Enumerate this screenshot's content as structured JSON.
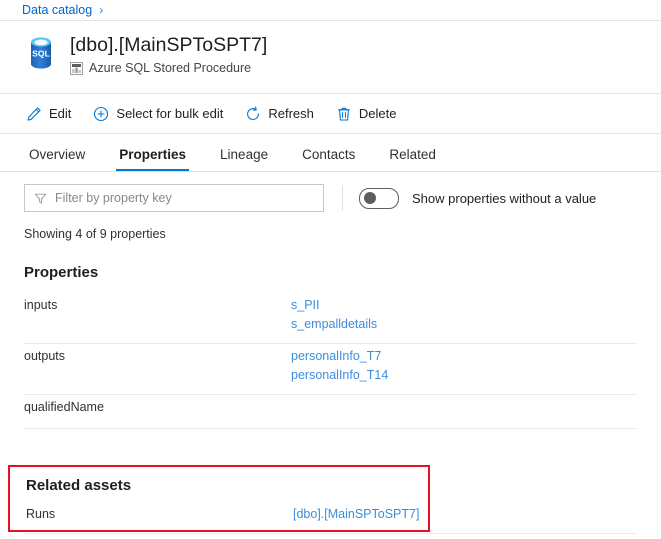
{
  "breadcrumb": {
    "items": [
      {
        "label": "Data catalog",
        "separator": "›"
      }
    ]
  },
  "asset": {
    "title": "[dbo].[MainSPToSPT7]",
    "subtitle": "Azure SQL Stored Procedure",
    "icon": "azure-sql-database-icon",
    "subtype_icon": "asset-type-icon"
  },
  "command_bar": {
    "items": [
      {
        "label": "Edit",
        "icon": "pencil-icon"
      },
      {
        "label": "Select for bulk edit",
        "icon": "plus-circle-icon"
      },
      {
        "label": "Refresh",
        "icon": "refresh-icon"
      },
      {
        "label": "Delete",
        "icon": "trash-icon"
      }
    ]
  },
  "tabs": [
    {
      "label": "Overview",
      "active": false
    },
    {
      "label": "Properties",
      "active": true
    },
    {
      "label": "Lineage",
      "active": false
    },
    {
      "label": "Contacts",
      "active": false
    },
    {
      "label": "Related",
      "active": false
    }
  ],
  "filter": {
    "placeholder": "Filter by property key",
    "value": "",
    "icon": "funnel-icon"
  },
  "toggle": {
    "label": "Show properties without a value",
    "state": "off"
  },
  "showing_text": "Showing 4 of 9 properties",
  "properties_section": {
    "heading": "Properties",
    "rows": [
      {
        "key": "inputs",
        "values": [
          "s_PII",
          "s_empalldetails"
        ]
      },
      {
        "key": "outputs",
        "values": [
          "personalInfo_T7",
          "personalInfo_T14"
        ]
      },
      {
        "key": "qualifiedName",
        "values": []
      }
    ]
  },
  "related_assets": {
    "heading": "Related assets",
    "rows": [
      {
        "key": "Runs",
        "values": [
          "[dbo].[MainSPToSPT7]"
        ]
      }
    ]
  },
  "colors": {
    "accent": "#0078d4",
    "link": "#3b8ede",
    "breadcrumb_link": "#0066cc",
    "annotation": "#e81123",
    "divider": "#edebe9",
    "sql_icon": "#2e7dd1"
  }
}
